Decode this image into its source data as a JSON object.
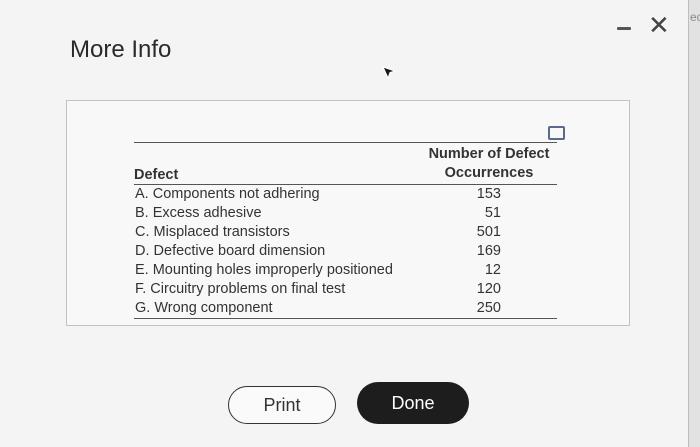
{
  "dialog": {
    "title": "More Info",
    "close_glyph": "✕"
  },
  "edge_text": "ec",
  "table": {
    "headers": {
      "defect": "Defect",
      "occurrences_line1": "Number of Defect",
      "occurrences_line2": "Occurrences"
    },
    "rows": [
      {
        "defect": "A. Components not adhering",
        "count": "153"
      },
      {
        "defect": "B. Excess adhesive",
        "count": "51"
      },
      {
        "defect": "C. Misplaced transistors",
        "count": "501"
      },
      {
        "defect": "D. Defective board dimension",
        "count": "169"
      },
      {
        "defect": "E. Mounting holes improperly positioned",
        "count": "12"
      },
      {
        "defect": "F. Circuitry problems on final test",
        "count": "120"
      },
      {
        "defect": "G. Wrong component",
        "count": "250"
      }
    ]
  },
  "buttons": {
    "print": "Print",
    "done": "Done"
  },
  "icons": {
    "minimize": "minimize-icon",
    "close": "close-icon",
    "copy": "copy-icon",
    "cursor": "mouse-cursor-icon"
  }
}
